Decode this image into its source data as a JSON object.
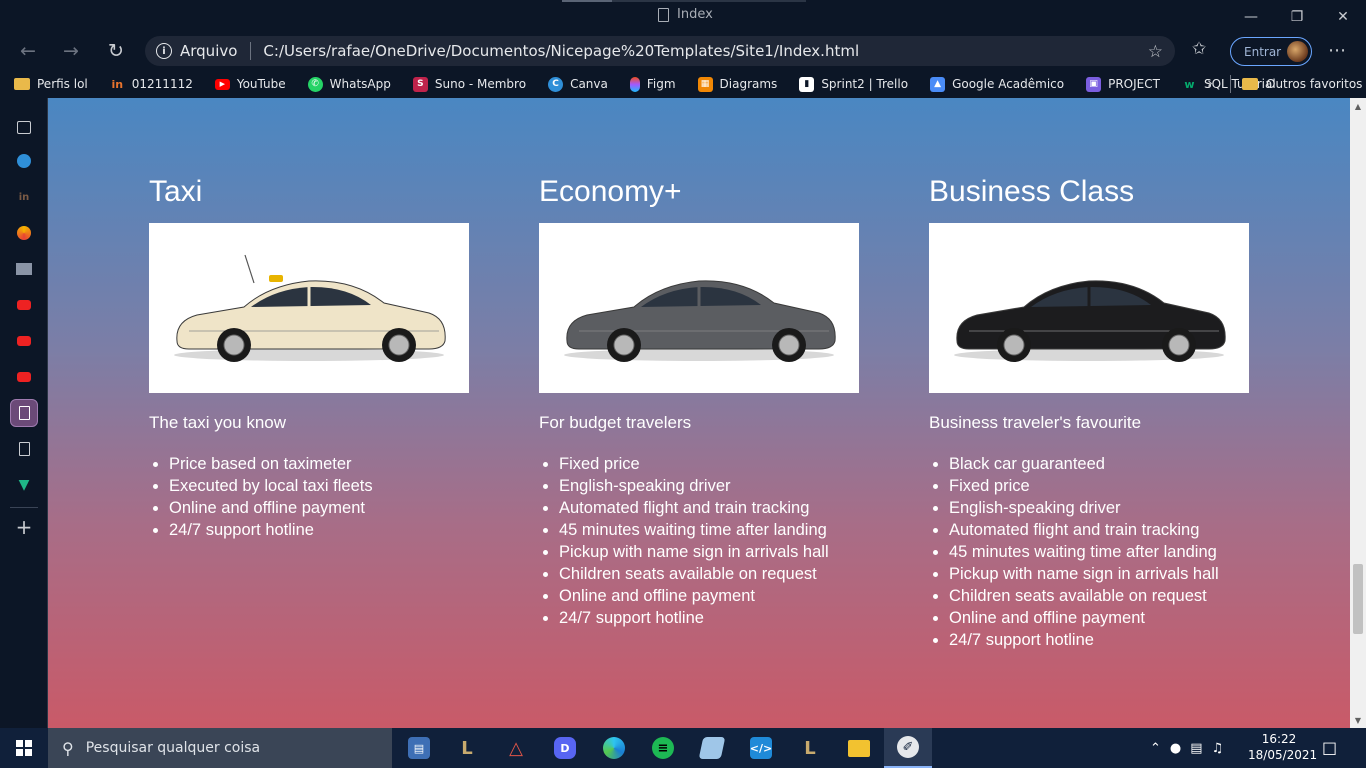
{
  "window": {
    "title": "Index"
  },
  "address_bar": {
    "scheme_label": "Arquivo",
    "url": "C:/Users/rafae/OneDrive/Documentos/Nicepage%20Templates/Site1/Index.html",
    "signin_label": "Entrar"
  },
  "bookmarks": {
    "items": [
      {
        "label": "Perfis lol",
        "icon": "folder-icon",
        "color": "#e9b94a"
      },
      {
        "label": "01211112",
        "icon": "logo-icon",
        "color": "#e8732d"
      },
      {
        "label": "YouTube",
        "icon": "youtube-icon",
        "color": "#ff0000"
      },
      {
        "label": "WhatsApp",
        "icon": "whatsapp-icon",
        "color": "#25d366"
      },
      {
        "label": "Suno - Membro",
        "icon": "suno-icon",
        "color": "#c0234b"
      },
      {
        "label": "Canva",
        "icon": "canva-icon",
        "color": "#2f8fd8"
      },
      {
        "label": "Figm",
        "icon": "figma-icon",
        "color": "#a259ff"
      },
      {
        "label": "Diagrams",
        "icon": "diagrams-icon",
        "color": "#f08705"
      },
      {
        "label": "Sprint2 | Trello",
        "icon": "trello-icon",
        "color": "#ffffff"
      },
      {
        "label": "Google Acadêmico",
        "icon": "scholar-icon",
        "color": "#4a8cf7"
      },
      {
        "label": "PROJECT",
        "icon": "project-icon",
        "color": "#7b5ee0"
      },
      {
        "label": "SQL Tutorial",
        "icon": "w3schools-icon",
        "color": "#04aa6d"
      }
    ],
    "other_label": "Outros favoritos"
  },
  "page": {
    "cards": [
      {
        "title": "Taxi",
        "image": "taxi-car",
        "car_color": "#efe4c8",
        "subtitle": "The taxi you know",
        "features": [
          "Price based on taximeter",
          "Executed by local taxi fleets",
          "Online and offline payment",
          "24/7 support hotline"
        ]
      },
      {
        "title": "Economy+",
        "image": "economy-car",
        "car_color": "#5b5d61",
        "subtitle": "For budget travelers",
        "features": [
          "Fixed price",
          "English-speaking driver",
          "Automated flight and train tracking",
          "45 minutes waiting time after landing",
          "Pickup with name sign in arrivals hall",
          "Children seats available on request",
          "Online and offline payment",
          "24/7 support hotline"
        ]
      },
      {
        "title": "Business Class",
        "image": "business-car",
        "car_color": "#1c1c1e",
        "subtitle": "Business traveler's favourite",
        "features": [
          "Black car guaranteed",
          "Fixed price",
          "English-speaking driver",
          "Automated flight and train tracking",
          "45 minutes waiting time after landing",
          "Pickup with name sign in arrivals hall",
          "Children seats available on request",
          "Online and offline payment",
          "24/7 support hotline"
        ]
      }
    ]
  },
  "taskbar": {
    "search_placeholder": "Pesquisar qualquer coisa",
    "time": "16:22",
    "date": "18/05/2021"
  }
}
